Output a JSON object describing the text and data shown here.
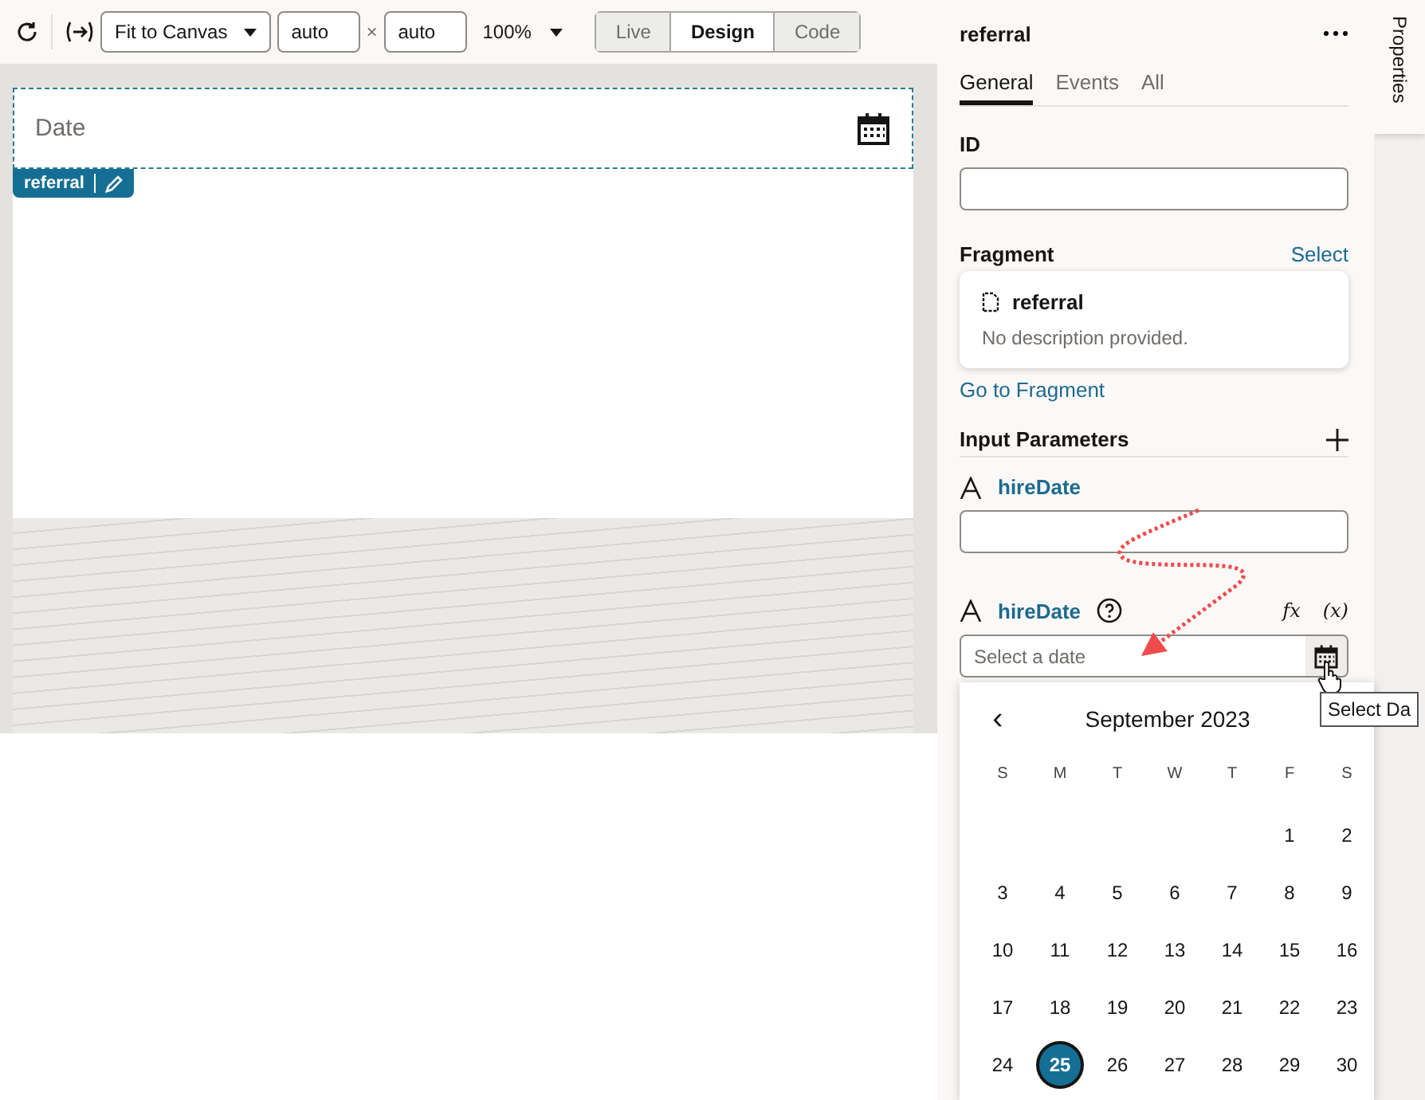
{
  "toolbar": {
    "fit": "Fit to Canvas",
    "width": "auto",
    "times": "×",
    "height": "auto",
    "zoom": "100%",
    "modes": [
      {
        "label": "Live",
        "selected": false
      },
      {
        "label": "Design",
        "selected": true
      },
      {
        "label": "Code",
        "selected": false
      }
    ]
  },
  "canvas": {
    "field_label": "Date",
    "badge": "referral"
  },
  "panel": {
    "title": "referral",
    "tabs": [
      {
        "label": "General",
        "selected": true
      },
      {
        "label": "Events",
        "selected": false
      },
      {
        "label": "All",
        "selected": false
      }
    ],
    "id_label": "ID",
    "fragment_label": "Fragment",
    "select_link": "Select",
    "fragment_card": {
      "name": "referral",
      "description": "No description provided."
    },
    "go_link": "Go to Fragment",
    "input_parameters": "Input Parameters",
    "params": [
      {
        "name": "hireDate",
        "kind": "text",
        "help": false
      },
      {
        "name": "hireDate",
        "kind": "date",
        "help": true,
        "placeholder": "Select a date",
        "fx": "fx",
        "var": "(x)"
      }
    ]
  },
  "tooltip": "Select Da",
  "calendar": {
    "month": "September 2023",
    "prev": "‹",
    "weekdays": [
      "S",
      "M",
      "T",
      "W",
      "T",
      "F",
      "S"
    ],
    "weeks": [
      [
        {
          "label": "1",
          "selected": false
        },
        {
          "label": "2",
          "selected": false
        }
      ],
      [
        {
          "label": "3",
          "selected": false
        },
        {
          "label": "4",
          "selected": false
        },
        {
          "label": "5",
          "selected": false
        },
        {
          "label": "6",
          "selected": false
        },
        {
          "label": "7",
          "selected": false
        },
        {
          "label": "8",
          "selected": false
        },
        {
          "label": "9",
          "selected": false
        }
      ],
      [
        {
          "label": "10",
          "selected": false
        },
        {
          "label": "11",
          "selected": false
        },
        {
          "label": "12",
          "selected": false
        },
        {
          "label": "13",
          "selected": false
        },
        {
          "label": "14",
          "selected": false
        },
        {
          "label": "15",
          "selected": false
        },
        {
          "label": "16",
          "selected": false
        }
      ],
      [
        {
          "label": "17",
          "selected": false
        },
        {
          "label": "18",
          "selected": false
        },
        {
          "label": "19",
          "selected": false
        },
        {
          "label": "20",
          "selected": false
        },
        {
          "label": "21",
          "selected": false
        },
        {
          "label": "22",
          "selected": false
        },
        {
          "label": "23",
          "selected": false
        }
      ],
      [
        {
          "label": "24",
          "selected": false
        },
        {
          "label": "25",
          "selected": true
        },
        {
          "label": "26",
          "selected": false
        },
        {
          "label": "27",
          "selected": false
        },
        {
          "label": "28",
          "selected": false
        },
        {
          "label": "29",
          "selected": false
        },
        {
          "label": "30",
          "selected": false
        }
      ]
    ]
  },
  "side_tab": "Properties"
}
